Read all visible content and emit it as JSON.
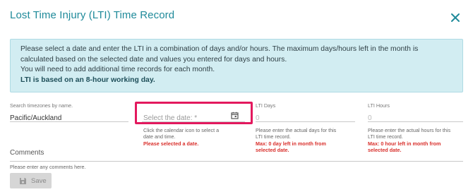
{
  "dialog": {
    "title": "Lost Time Injury (LTI) Time Record",
    "close_icon": "close-icon"
  },
  "info": {
    "line1": "Please select a date and enter the LTI in a combination of days and/or hours. The maximum days/hours left in the month is",
    "line2": "calculated based on the selected date and values you entered for days and hours.",
    "line3": "You will need to add additional time records for each month.",
    "line4": "LTI is based on an 8-hour working day."
  },
  "timezone": {
    "label": "Search timezones by name.",
    "value": "Pacific/Auckland"
  },
  "date": {
    "placeholder": "Select the date: *",
    "icon": "calendar-icon",
    "help_line1": "Click the calendar icon to select a",
    "help_line2": "date and time.",
    "error": "Please selected a date."
  },
  "lti_days": {
    "label": "LTI Days",
    "value": "0",
    "help_line1": "Please enter the actual days for this",
    "help_line2": "LTI time record.",
    "error_line1": "Max: 0 day left in month from",
    "error_line2": "selected date."
  },
  "lti_hours": {
    "label": "LTI Hours",
    "value": "0",
    "help_line1": "Please enter the actual hours for this",
    "help_line2": "LTI time record.",
    "error_line1": "Max: 0 hour left in month from",
    "error_line2": "selected date."
  },
  "comments": {
    "label": "Comments",
    "help": "Please enter any comments here."
  },
  "save": {
    "label": "Save",
    "icon": "floppy-disk-icon"
  },
  "colors": {
    "title": "#1f8a9a",
    "info_bg": "#d2edf2",
    "highlight": "#e3195e",
    "error": "#d9302c"
  }
}
